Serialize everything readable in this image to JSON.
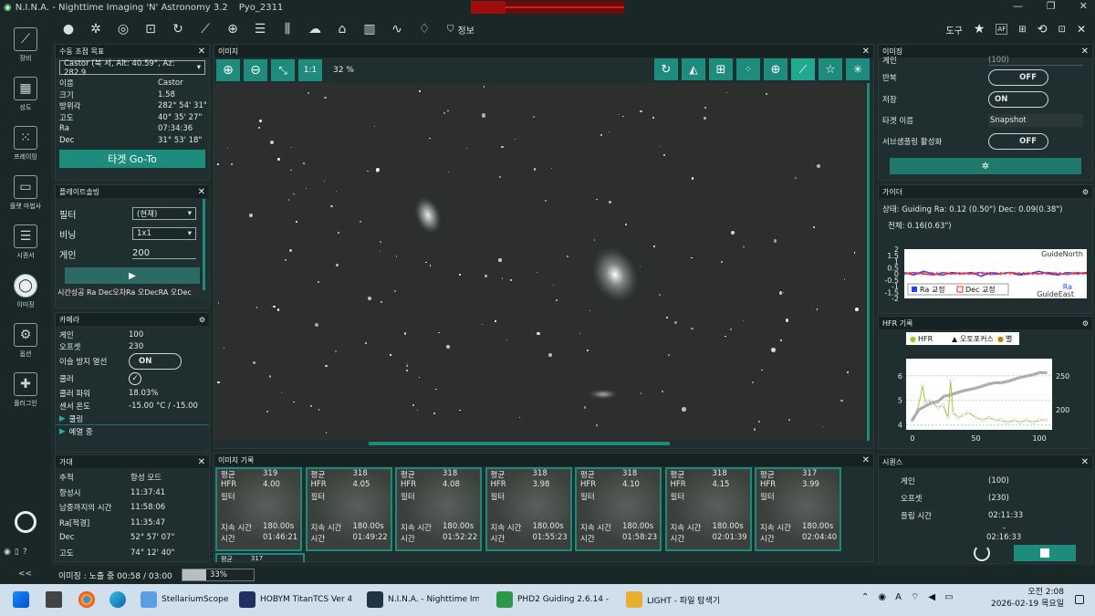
{
  "window": {
    "title": "N.I.N.A. - Nighttime Imaging 'N' Astronomy 3.2",
    "profile": "Pyo_2311",
    "minimize": "—",
    "maximize": "❐",
    "close": "✕"
  },
  "toolbar": {
    "info_label": "정보",
    "tools_label": "도구",
    "af_label": "AF"
  },
  "sidebar": [
    {
      "label": "장비",
      "icon": "telescope-icon"
    },
    {
      "label": "성도",
      "icon": "sky-atlas-icon"
    },
    {
      "label": "프레이밍",
      "icon": "framing-icon"
    },
    {
      "label": "플랫 마법사",
      "icon": "flat-wizard-icon"
    },
    {
      "label": "시퀀서",
      "icon": "sequencer-icon"
    },
    {
      "label": "이미징",
      "icon": "imaging-icon"
    },
    {
      "label": "옵션",
      "icon": "gear-icon"
    },
    {
      "label": "플러그인",
      "icon": "puzzle-icon"
    }
  ],
  "target_panel": {
    "title": "수동 초점 목표",
    "selected": "Castor (북 서, Alt: 40.59°, Az: 282.9",
    "rows": [
      {
        "k": "이름",
        "v": "Castor"
      },
      {
        "k": "크기",
        "v": "1.58"
      },
      {
        "k": "방위각",
        "v": "282° 54' 31\""
      },
      {
        "k": "고도",
        "v": "40° 35' 27\""
      },
      {
        "k": "Ra",
        "v": "07:34:36"
      },
      {
        "k": "Dec",
        "v": "31° 53' 18\""
      }
    ],
    "goto": "타겟 Go-To"
  },
  "platesolve_panel": {
    "title": "플레이트솔빙",
    "filter_label": "필터",
    "filter_value": "(현재)",
    "binning_label": "비닝",
    "binning_value": "1x1",
    "gain_label": "게인",
    "gain_value": "200",
    "columns": "시간성공 Ra Dec오차Ra 오DecRA 오Dec"
  },
  "camera_panel": {
    "title": "카메라",
    "rows": [
      {
        "k": "게인",
        "v": "100"
      },
      {
        "k": "오프셋",
        "v": "230"
      }
    ],
    "antidew_label": "이슬 방지 열선",
    "antidew_value": "ON",
    "cooler_label": "쿨러",
    "cooler_power_label": "쿨러 파워",
    "cooler_power": "18.03%",
    "sensor_temp_label": "센서 온도",
    "sensor_temp": "-15.00 °C / -15.00",
    "cooling_label": "쿨링",
    "warming_label": "예열 중"
  },
  "mount_panel": {
    "title": "가대",
    "rows": [
      {
        "k": "추적",
        "v": "항성 모드"
      },
      {
        "k": "항성시",
        "v": "11:37:41"
      },
      {
        "k": "남중까지의 시간",
        "v": "11:58:06"
      },
      {
        "k": "Ra[적경]",
        "v": "11:35:47"
      },
      {
        "k": "Dec",
        "v": "52° 57' 07\""
      },
      {
        "k": "고도",
        "v": "74° 12' 40\""
      }
    ]
  },
  "image_panel": {
    "title": "이미지",
    "zoom_label": "1:1",
    "zoom": "32 %"
  },
  "history_panel": {
    "title": "이미지 기록",
    "labels": {
      "mean": "평균",
      "hfr": "HFR",
      "filter": "필터",
      "duration": "지속 시간",
      "time": "시간"
    },
    "items": [
      {
        "mean": "319",
        "hfr": "4.00",
        "duration": "180.00s",
        "time": "01:46:21"
      },
      {
        "mean": "318",
        "hfr": "4.05",
        "duration": "180.00s",
        "time": "01:49:22"
      },
      {
        "mean": "318",
        "hfr": "4.08",
        "duration": "180.00s",
        "time": "01:52:22"
      },
      {
        "mean": "318",
        "hfr": "3.98",
        "duration": "180.00s",
        "time": "01:55:23"
      },
      {
        "mean": "318",
        "hfr": "4.10",
        "duration": "180.00s",
        "time": "01:58:23"
      },
      {
        "mean": "318",
        "hfr": "4.15",
        "duration": "180.00s",
        "time": "02:01:39"
      },
      {
        "mean": "317",
        "hfr": "3.99",
        "duration": "180.00s",
        "time": "02:04:40"
      }
    ],
    "partial_label": "평균",
    "partial_value": "317"
  },
  "imaging_panel": {
    "title": "이미징",
    "gain_label": "게인",
    "gain_value": "(100)",
    "repeat_label": "반복",
    "repeat_value": "OFF",
    "save_label": "저장",
    "save_value": "ON",
    "target_label": "타겟 이름",
    "target_value": "Snapshot",
    "subsample_label": "서브샘플링 활성화",
    "subsample_value": "OFF"
  },
  "guider_panel": {
    "title": "가이더",
    "status": "상태: Guiding  Ra: 0.12 (0.50\")  Dec: 0.09(0.38\")",
    "total": "전체: 0.16(0.63\")",
    "north": "GuideNorth",
    "east": "GuideEast",
    "legend_ra": "Ra 교정",
    "legend_dec": "Dec 교정",
    "legend_ra2": "Ra",
    "y_ticks": [
      "2",
      "1.5",
      "1",
      "0.5",
      "0",
      "-0.5",
      "-1",
      "-1.5",
      "-2"
    ]
  },
  "hfr_panel": {
    "title": "HFR 기록",
    "legend": [
      "HFR",
      "오토포커스",
      "별"
    ]
  },
  "sequence_panel": {
    "title": "시퀀스",
    "rows": [
      {
        "k": "게인",
        "v": "(100)"
      },
      {
        "k": "오프셋",
        "v": "(230)"
      },
      {
        "k": "플립 시간",
        "v": "02:11:33"
      }
    ],
    "dash": "-",
    "end_time": "02:16:33"
  },
  "status_bar": {
    "text": "이미징 :  노출 중 00:58 / 03:00",
    "percent": "33%",
    "progress": 0.33,
    "collapse": "<<"
  },
  "taskbar": {
    "apps": [
      "StellariumScope",
      "HOBYM TitanTCS Ver 4.0",
      "N.I.N.A. - Nighttime Ima",
      "PHD2 Guiding 2.6.14 - A",
      "LIGHT - 파일 탐색기"
    ],
    "lang": "A",
    "clock_time": "오전 2:08",
    "clock_date": "2026-02-19 목요일"
  },
  "chart_data": [
    {
      "type": "line",
      "title": "HFR 기록",
      "xlim": [
        -5,
        110
      ],
      "x_ticks": [
        "0",
        "50",
        "100"
      ],
      "y_left_ticks": [
        "4",
        "5",
        "6"
      ],
      "y_right_ticks": [
        "200",
        "250"
      ],
      "ylim_left": [
        3.8,
        6.4
      ],
      "ylim_right": [
        170,
        265
      ],
      "series": [
        {
          "name": "HFR",
          "axis": "left",
          "color": "#ffffff",
          "x": [
            0,
            4,
            8,
            10,
            12,
            16,
            20,
            24,
            28,
            30,
            32,
            36,
            40,
            44,
            50,
            55,
            60,
            65,
            70,
            75,
            80,
            85,
            90,
            95,
            100,
            105
          ],
          "values": [
            4.2,
            4.6,
            5.6,
            4.9,
            5.0,
            4.9,
            4.7,
            4.8,
            4.3,
            5.8,
            4.5,
            4.3,
            4.4,
            4.5,
            4.3,
            4.2,
            4.3,
            4.2,
            4.2,
            4.1,
            4.2,
            4.1,
            4.2,
            4.1,
            4.2,
            4.2
          ]
        },
        {
          "name": "별",
          "axis": "right",
          "color": "#bfbfbf",
          "x": [
            0,
            5,
            10,
            15,
            20,
            25,
            30,
            35,
            40,
            45,
            50,
            55,
            60,
            65,
            70,
            75,
            80,
            85,
            90,
            95,
            100,
            105
          ],
          "values": [
            185,
            200,
            205,
            210,
            212,
            220,
            222,
            225,
            228,
            230,
            232,
            235,
            238,
            240,
            240,
            242,
            245,
            248,
            250,
            252,
            255,
            255
          ]
        }
      ]
    },
    {
      "type": "line",
      "title": "",
      "ylim": [
        -2,
        2
      ],
      "series": [
        {
          "name": "Ra",
          "color": "#2244ff",
          "values": [
            0.1,
            -0.1,
            0.2,
            0,
            -0.1,
            0.1,
            0,
            0.1,
            -0.2,
            0.1,
            0,
            0.1,
            -0.1,
            0,
            0.2,
            0,
            -0.1,
            0.1,
            0,
            0.1
          ]
        },
        {
          "name": "Dec",
          "color": "#ff2222",
          "values": [
            0,
            0.1,
            0,
            -0.1,
            0.1,
            0,
            0.05,
            0,
            0.1,
            -0.05,
            0,
            0.1,
            0,
            0.05,
            0,
            0.1,
            0,
            -0.05,
            0.1,
            0
          ]
        }
      ]
    }
  ]
}
